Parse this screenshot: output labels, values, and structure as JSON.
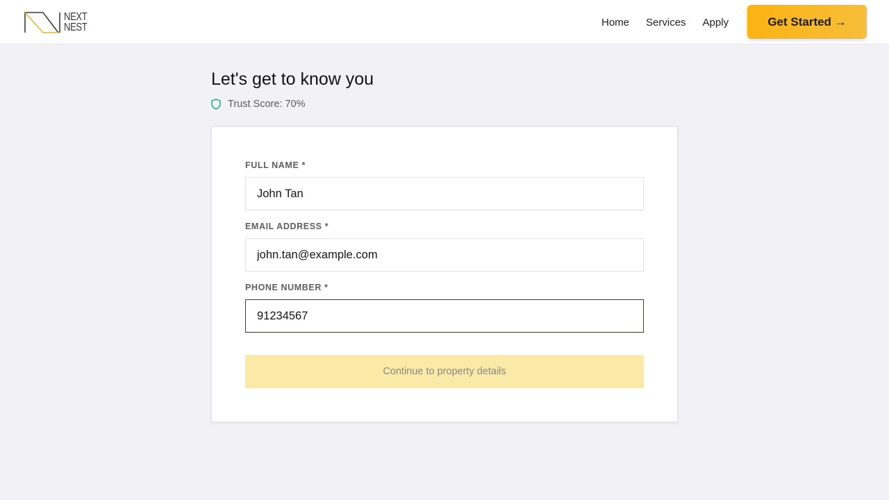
{
  "brand": {
    "logo_line1": "NEXT",
    "logo_line2": "NEST",
    "accent_color": "#fbb312"
  },
  "nav": {
    "items": [
      "Home",
      "Services",
      "Apply"
    ],
    "cta_label": "Get Started →"
  },
  "page": {
    "heading": "Let's get to know you",
    "trust_icon": "shield-icon",
    "trust_score": "Trust Score: 70%"
  },
  "form": {
    "full_name": {
      "label": "FULL NAME *",
      "value": "John Tan"
    },
    "email": {
      "label": "EMAIL ADDRESS *",
      "value": "john.tan@example.com"
    },
    "phone": {
      "label": "PHONE NUMBER *",
      "value": "91234567"
    },
    "submit_label": "Continue to property details"
  }
}
